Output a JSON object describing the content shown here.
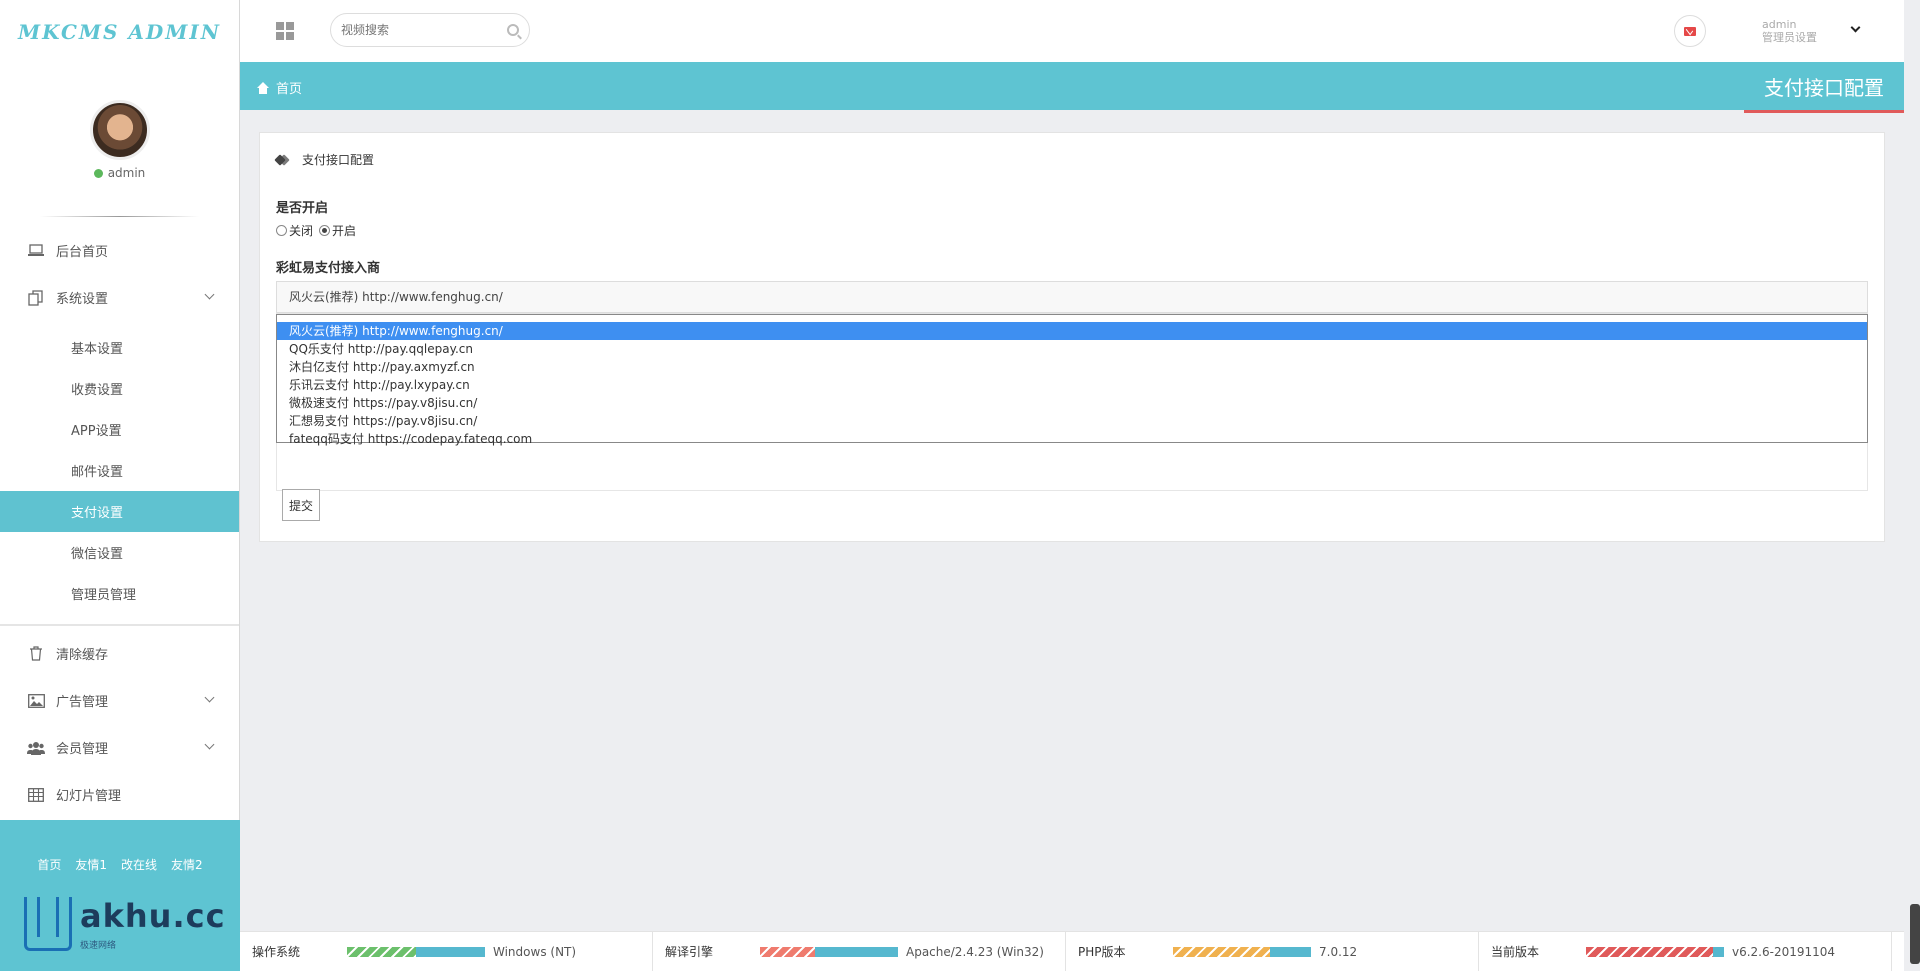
{
  "app": {
    "logo": "MKCMS ADMIN"
  },
  "profile": {
    "name": "admin"
  },
  "sidebar": {
    "items": [
      {
        "label": "后台首页",
        "icon": "laptop-icon"
      },
      {
        "label": "系统设置",
        "icon": "copy-icon"
      }
    ],
    "subitems": [
      "基本设置",
      "收费设置",
      "APP设置",
      "邮件设置",
      "支付设置",
      "微信设置",
      "管理员管理"
    ],
    "active_sub": "支付设置",
    "items2": [
      {
        "label": "清除缓存",
        "icon": "trash-icon"
      },
      {
        "label": "广告管理",
        "icon": "image-icon"
      },
      {
        "label": "会员管理",
        "icon": "users-icon"
      },
      {
        "label": "幻灯片管理",
        "icon": "table-icon"
      }
    ],
    "footer_links": [
      "首页",
      "友情1",
      "改在线",
      "友情2"
    ],
    "brand": {
      "text": "akhu.cc",
      "sub": "极速网络"
    }
  },
  "topbar": {
    "search_placeholder": "视频搜索",
    "user_name": "admin",
    "user_role": "管理员设置"
  },
  "breadcrumb": {
    "home": "首页",
    "title": "支付接口配置"
  },
  "panel": {
    "heading": "支付接口配置",
    "enable_label": "是否开启",
    "radio_off": "关闭",
    "radio_on": "开启",
    "radio_selected": "开启",
    "provider_label": "彩虹易支付接入商",
    "select_value": "风火云(推荐) http://www.fenghug.cn/",
    "options": [
      "风火云(推荐) http://www.fenghug.cn/",
      "QQ乐支付 http://pay.qqlepay.cn",
      "沐白亿支付 http://pay.axmyzf.cn",
      "乐讯云支付 http://pay.lxypay.cn",
      "微极速支付 https://pay.v8jisu.cn/",
      "汇想易支付 https://pay.v8jisu.cn/",
      "fateqq码支付 https://codepay.fateqq.com"
    ],
    "submit": "提交"
  },
  "status": [
    {
      "label": "操作系统",
      "value": "Windows (NT)",
      "color_a": "#6cc06c",
      "fill_a": 0.5
    },
    {
      "label": "解译引擎",
      "value": "Apache/2.4.23 (Win32)",
      "color_a": "#ef7b6e",
      "fill_a": 0.4
    },
    {
      "label": "PHP版本",
      "value": "7.0.12",
      "color_a": "#f0b14f",
      "fill_a": 0.7
    },
    {
      "label": "当前版本",
      "value": "v6.2.6-20191104",
      "color_a": "#e05a5a",
      "fill_a": 0.92
    }
  ],
  "colors": {
    "accent": "#5ec4d2",
    "active": "#5fc2d0",
    "selected_option": "#3e8ff1",
    "title_underline": "#e05a5a"
  }
}
